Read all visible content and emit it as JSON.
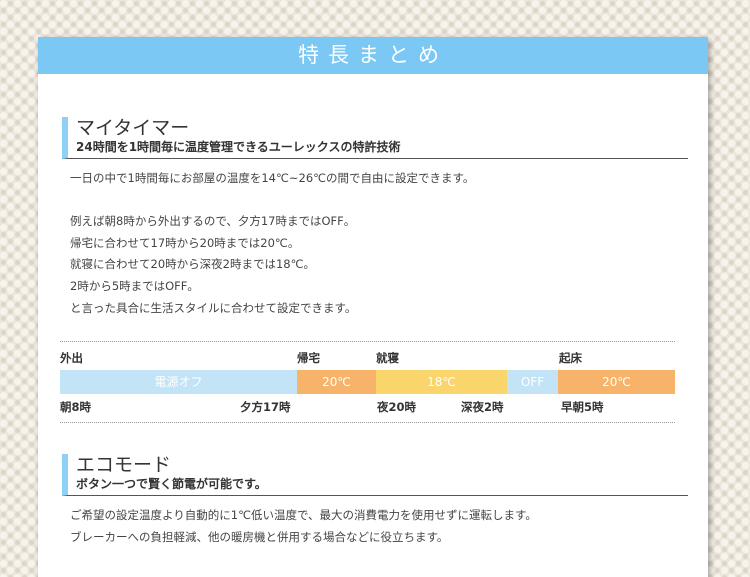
{
  "banner": {
    "title": "特長まとめ"
  },
  "section1": {
    "title": "マイタイマー",
    "subtitle": "24時間を1時間毎に温度管理できるユーレックスの特許技術",
    "lines": [
      "一日の中で1時間毎にお部屋の温度を14℃~26℃の間で自由に設定できます。",
      "",
      "例えば朝8時から外出するので、夕方17時まではOFF。",
      "帰宅に合わせて17時から20時までは20℃。",
      "就寝に合わせて20時から深夜2時までは18℃。",
      "2時から5時まではOFF。",
      "と言った具合に生活スタイルに合わせて設定できます。"
    ]
  },
  "timeline": {
    "top_labels": [
      "外出",
      "帰宅",
      "就寝",
      "起床"
    ],
    "segments": [
      {
        "label": "電源オフ",
        "color": "#c3e4f6"
      },
      {
        "label": "20℃",
        "color": "#f7b369"
      },
      {
        "label": "18℃",
        "color": "#fad56b"
      },
      {
        "label": "OFF",
        "color": "#c3e4f6"
      },
      {
        "label": "20℃",
        "color": "#f7b369"
      }
    ],
    "bottom_labels": [
      "朝8時",
      "夕方17時",
      "夜20時",
      "深夜2時",
      "早朝5時"
    ]
  },
  "section2": {
    "title": "エコモード",
    "subtitle": "ボタン一つで賢く節電が可能です。",
    "lines": [
      "ご希望の設定温度より自動的に1℃低い温度で、最大の消費電力を使用せずに運転します。",
      "ブレーカーへの負担軽減、他の暖房機と併用する場合などに役立ちます。"
    ]
  },
  "colors": {
    "accent": "#7cc8f4",
    "section_bar": "#8fd1f6"
  }
}
